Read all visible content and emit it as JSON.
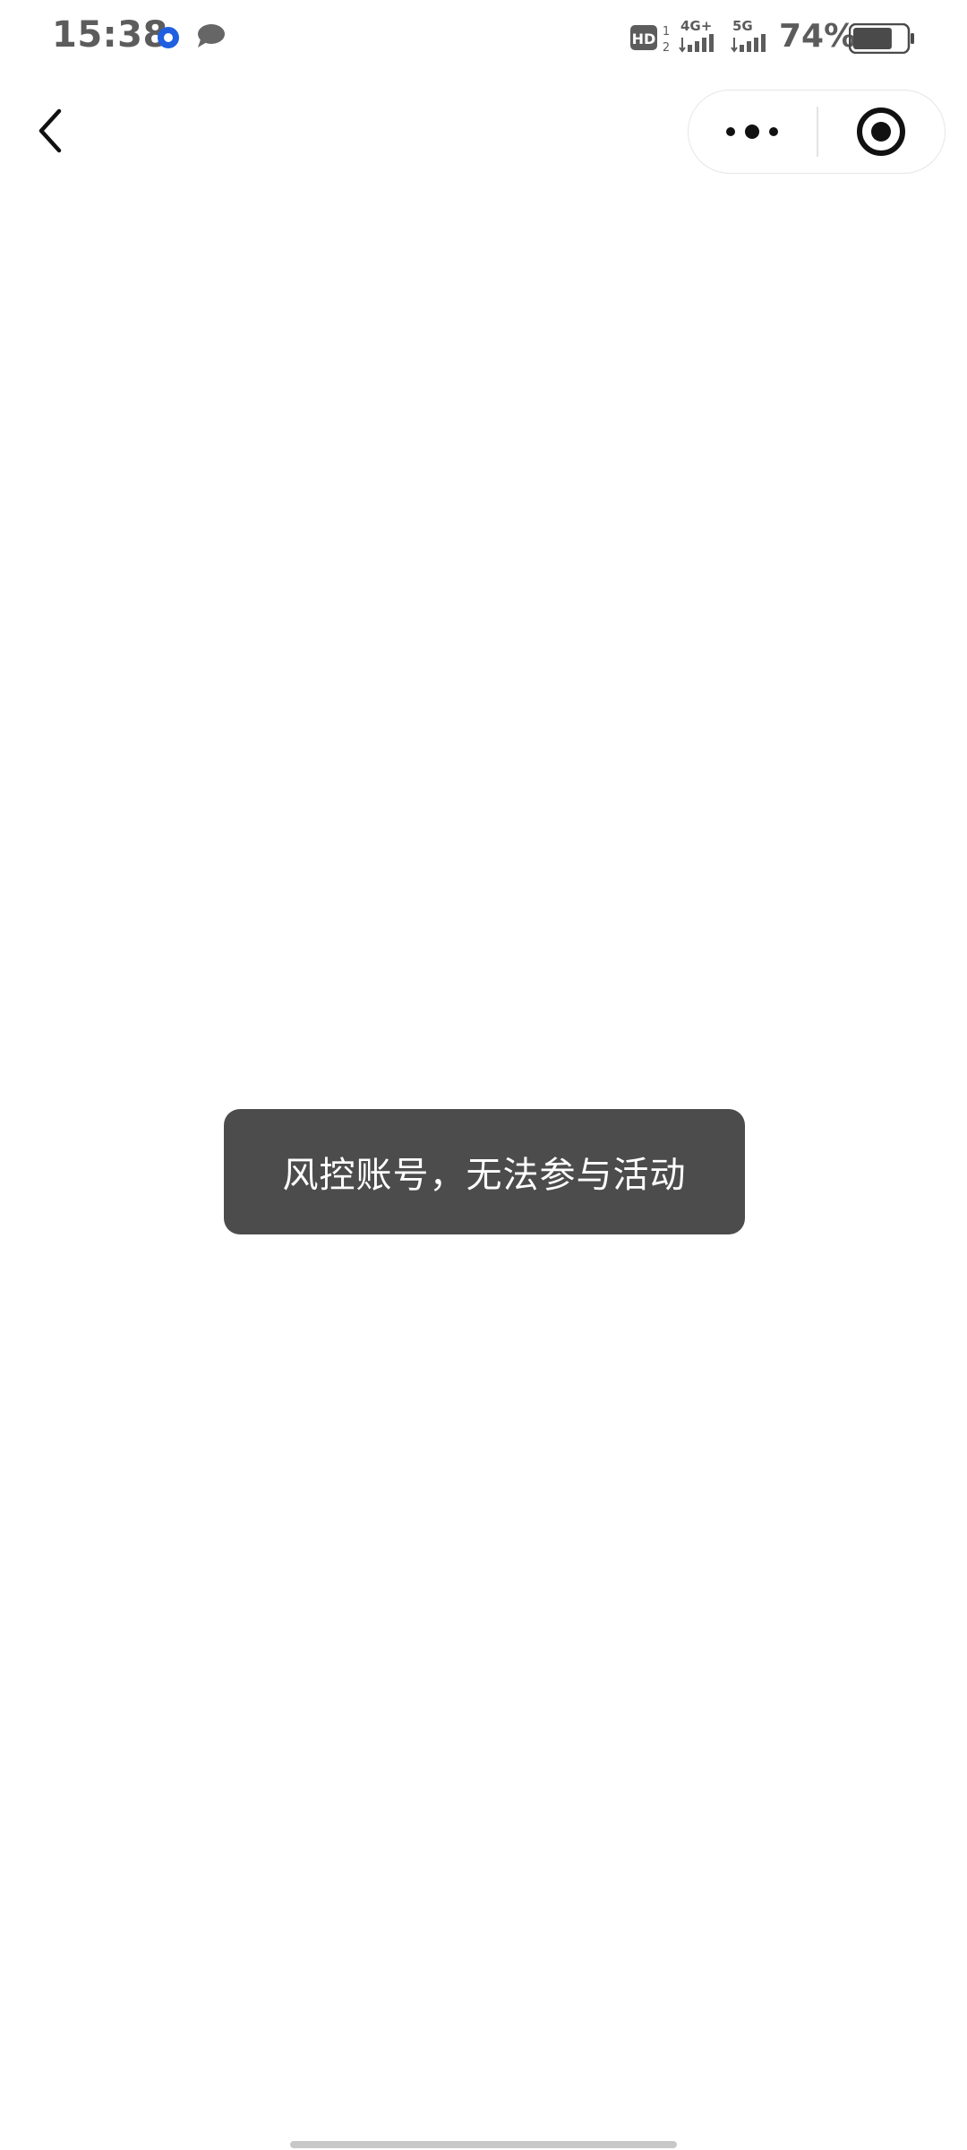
{
  "status_bar": {
    "time": "15:38",
    "battery_percent": "74%",
    "network_4g": "4G+",
    "network_5g": "5G",
    "hd_label": "HD",
    "sim1": "1",
    "sim2": "2",
    "battery_level": 0.74,
    "notification_app_color": "#1f5fe0"
  },
  "nav": {
    "back_icon": "chevron-left-icon",
    "more_icon": "more-dots-icon",
    "close_icon": "target-close-icon"
  },
  "toast": {
    "message": "风控账号，无法参与活动"
  }
}
